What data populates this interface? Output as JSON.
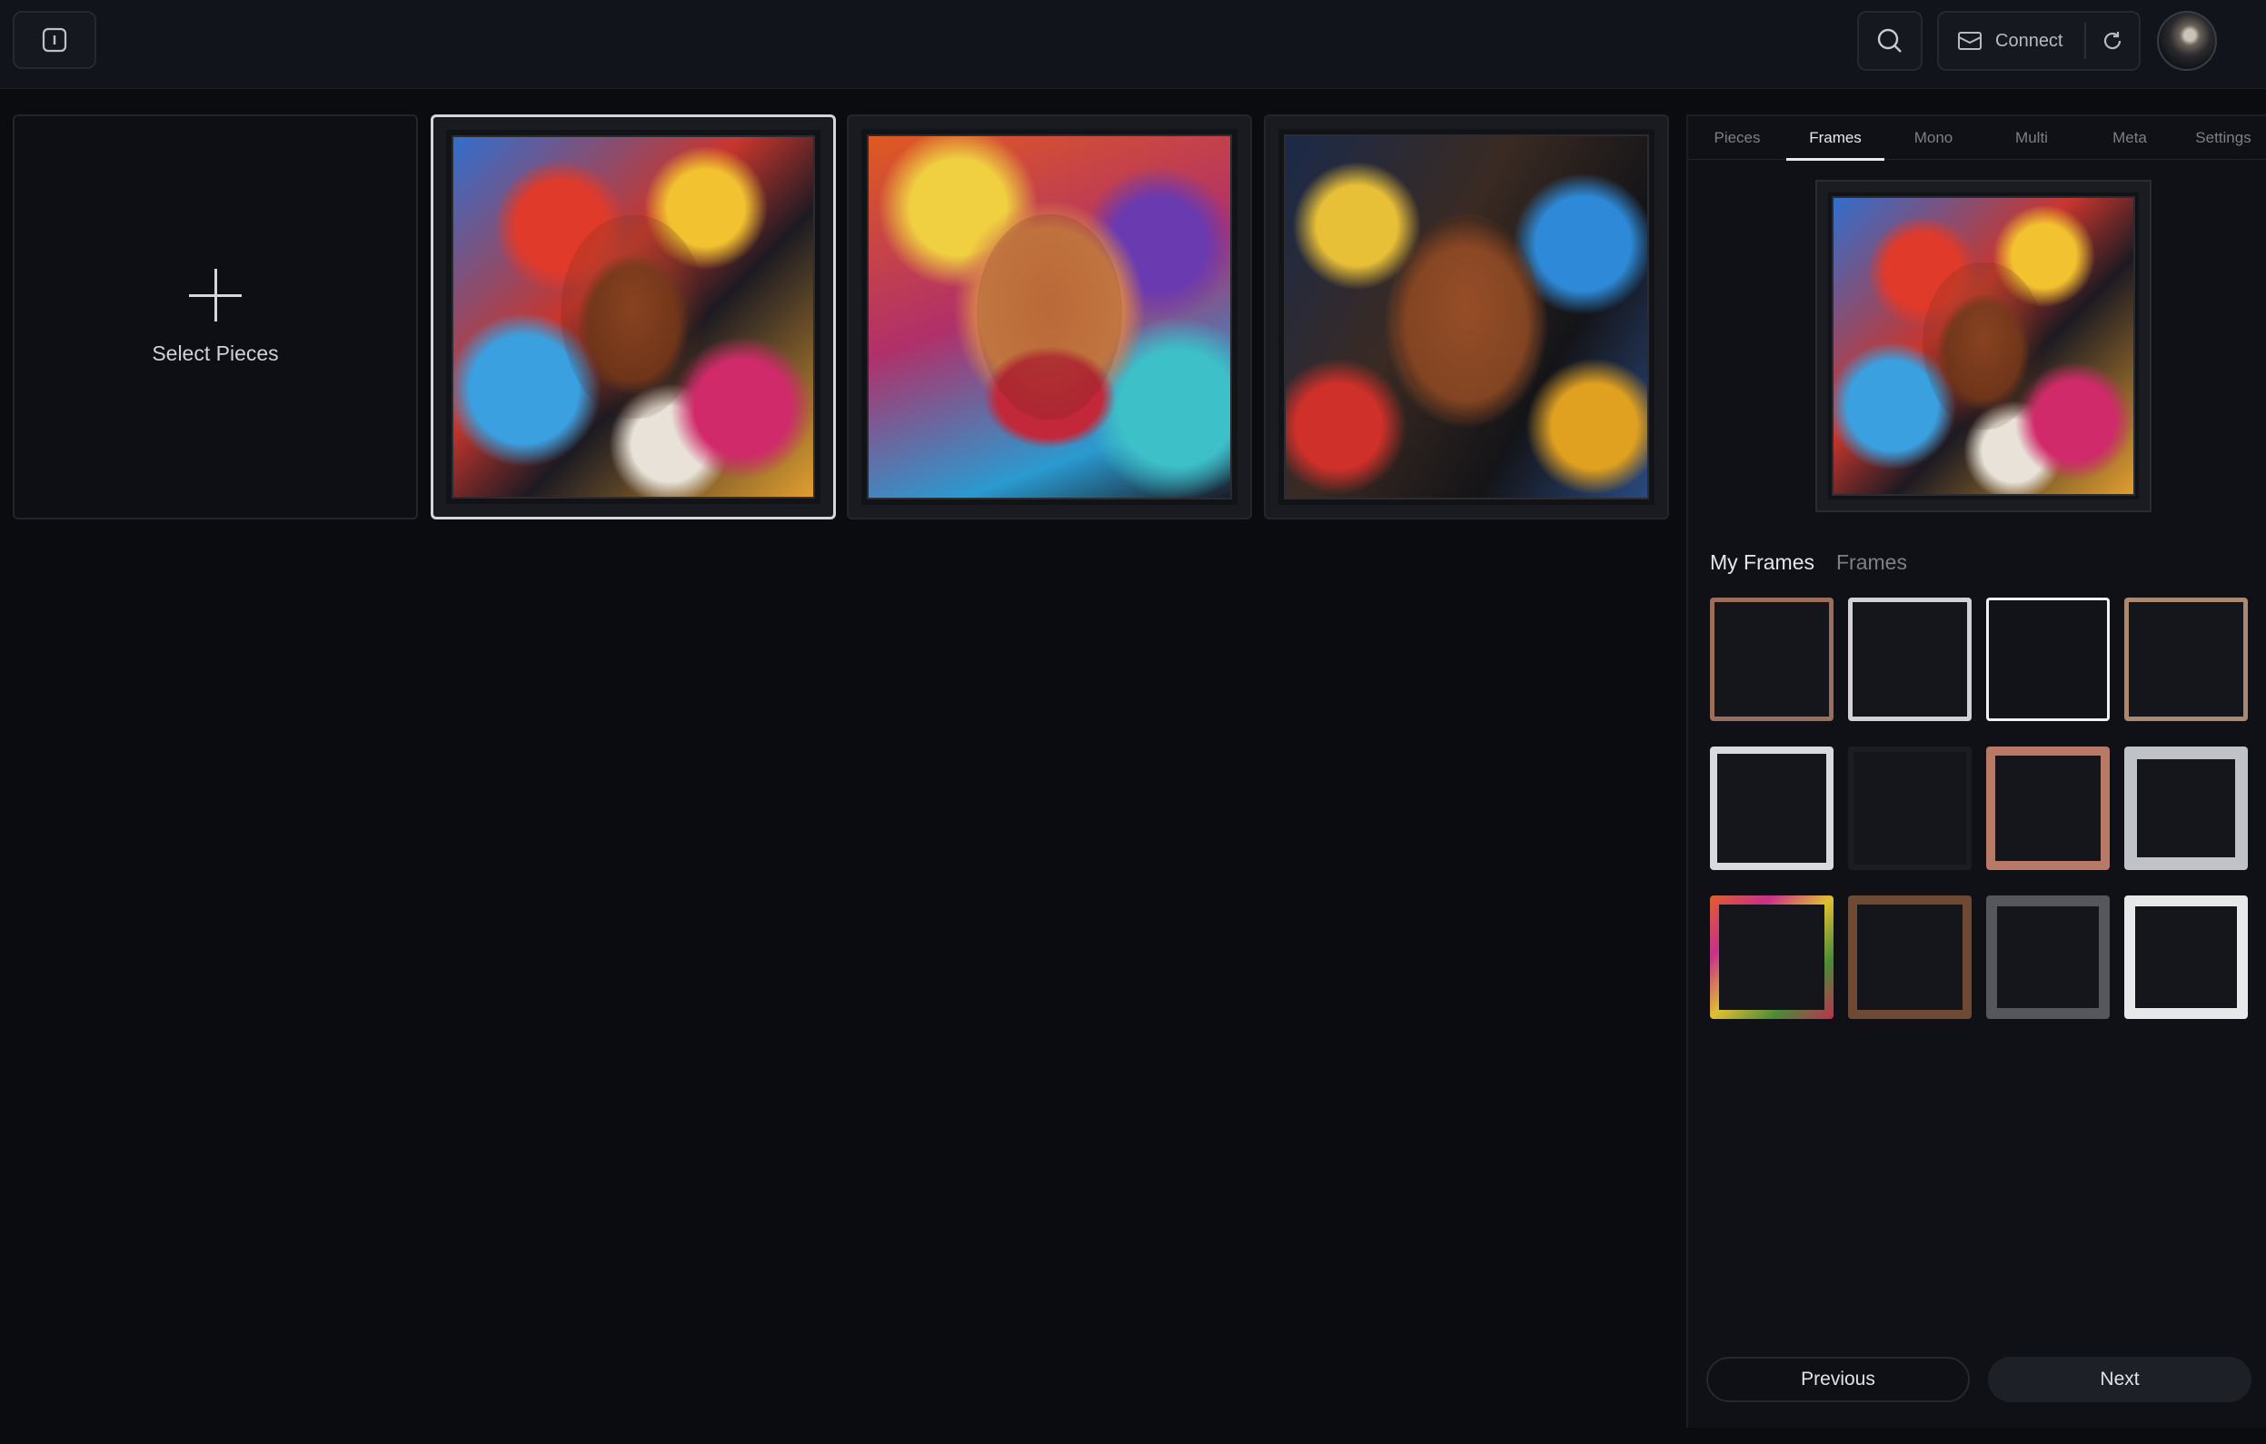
{
  "topbar": {
    "info_icon": "info-icon",
    "search_icon": "search-icon",
    "connect_icon": "mail-icon",
    "connect_label": "Connect",
    "refresh_icon": "refresh-icon",
    "avatar": "user-avatar"
  },
  "gallery": {
    "add_label": "Select Pieces",
    "add_icon": "plus-icon",
    "items": [
      {
        "name": "artwork-1",
        "selected": true
      },
      {
        "name": "artwork-2",
        "selected": false
      },
      {
        "name": "artwork-3",
        "selected": false
      }
    ]
  },
  "panel": {
    "tabs": [
      "Pieces",
      "Frames",
      "Mono",
      "Multi",
      "Meta",
      "Settings"
    ],
    "active_tab": "Frames",
    "sub_tabs": [
      "My Frames",
      "Frames"
    ],
    "active_sub_tab": "My Frames",
    "frames": [
      "copper",
      "silver",
      "black",
      "bronze",
      "white",
      "black-matte",
      "rose-gold",
      "silver-ornate",
      "multicolor",
      "dark-wood",
      "gunmetal",
      "marble"
    ],
    "selected_frame_index": 2,
    "previous_label": "Previous",
    "next_label": "Next"
  },
  "colors": {
    "background": "#0b0c10",
    "topbar": "#12141b",
    "panel": "#101117",
    "accent": "#e8e8ec"
  }
}
